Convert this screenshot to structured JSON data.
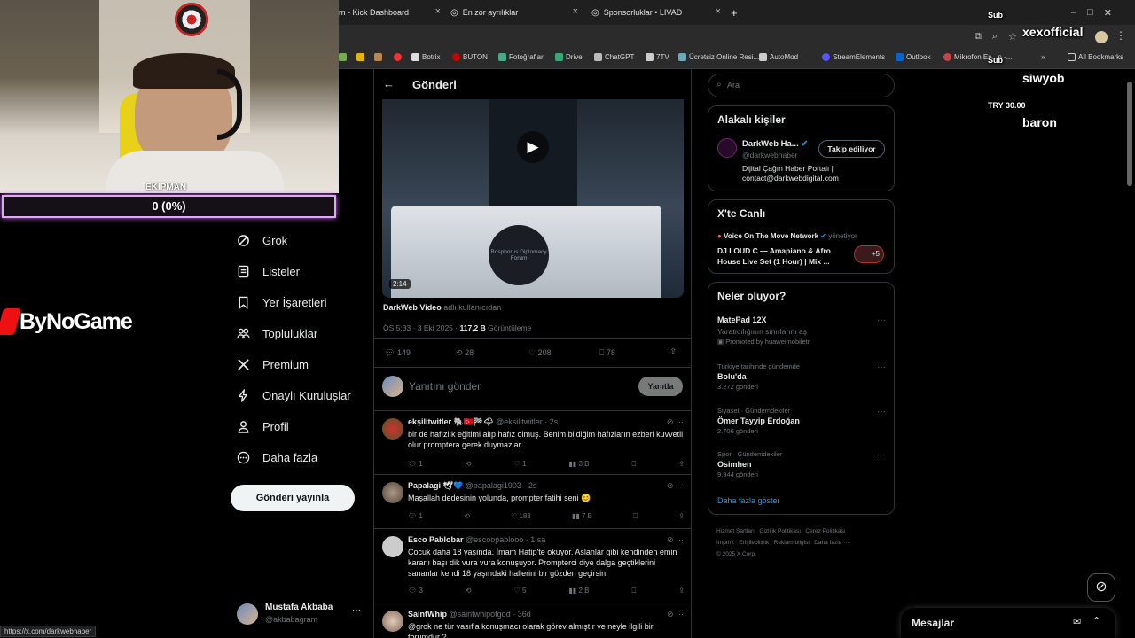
{
  "browser": {
    "tabs": [
      {
        "title": "m - Kick Dashboard"
      },
      {
        "title": "En zor ayrılıklar"
      },
      {
        "title": "Sponsorluklar • LIVAD"
      }
    ],
    "new_tab": "+",
    "bookmarks": [
      "Botrix",
      "BUTON",
      "Fotoğraflar",
      "Drive",
      "ChatGPT",
      "7TV",
      "Ücretsiz Online Resi...",
      "AutoMod",
      "StreamElements",
      "Outlook",
      "Mikrofon En...n -..."
    ],
    "all_bookmarks": "All Bookmarks",
    "status_url": "https://x.com/darkwebhaber"
  },
  "stream": {
    "ekip_label": "EKIPMAN",
    "progress_text": "0 (0%)",
    "progress_value": 0,
    "sponsor_logo": "ByNoGame",
    "sub_label_1": "Sub",
    "sub_name_1": "xexofficial",
    "sub_label_2": "Sub",
    "sub_name_2": "siwyob",
    "donation_amount": "TRY 30.00",
    "donation_name": "baron"
  },
  "sidebar": {
    "items": [
      {
        "label": "Grok",
        "icon": "grok-icon"
      },
      {
        "label": "Listeler",
        "icon": "list-icon"
      },
      {
        "label": "Yer İşaretleri",
        "icon": "bookmark-icon"
      },
      {
        "label": "Topluluklar",
        "icon": "communities-icon"
      },
      {
        "label": "Premium",
        "icon": "x-logo-icon"
      },
      {
        "label": "Onaylı Kuruluşlar",
        "icon": "lightning-icon"
      },
      {
        "label": "Profil",
        "icon": "profile-icon"
      },
      {
        "label": "Daha fazla",
        "icon": "more-circle-icon"
      }
    ],
    "post_button": "Gönderi yayınla",
    "account_name": "Mustafa Akbaba",
    "account_handle": "@akbabagram",
    "account_more": "···"
  },
  "post": {
    "header": "Gönderi",
    "video_duration": "2:14",
    "podium_text": "Bosphorus Diplomacy Forum",
    "attribution_name": "DarkWeb Video",
    "attribution_suffix": "adlı kullanıcıdan",
    "time": "ÖS 5:33 · 3 Eki 2025 ·",
    "views": "117,2 B",
    "views_label": "Görüntüleme",
    "replies": "149",
    "reposts": "28",
    "likes": "208",
    "bookmarks": "78",
    "reply_placeholder": "Yanıtını gönder",
    "reply_button": "Yanıtla"
  },
  "replies": [
    {
      "name": "ekşilitwitler 🐘🇹🇷🏁🌩",
      "handle": "@eksilitwitler · 2s",
      "text": "bir de hafızlık eğitimi alıp hafız olmuş. Benim bildiğim hafızların ezberi kuvvetli olur promptera gerek duymazlar.",
      "replies": "1",
      "reposts": "",
      "likes": "1",
      "views": "3 B"
    },
    {
      "name": "Papalagi 🕊💙",
      "handle": "@papalagi1903 · 2s",
      "text": "Maşallah dedesinin yolunda, prompter fatihi seni 😊",
      "replies": "1",
      "reposts": "",
      "likes": "183",
      "views": "7 B"
    },
    {
      "name": "Esco Pablobar",
      "handle": "@escoopablooo · 1 sa",
      "text": "Çocuk daha 18 yaşında. İmam Hatip'te okuyor. Aslanlar gibi kendinden emin kararlı başı dik vura vura konuşuyor. Prompterci diye dalga geçtiklerini sananlar kendi 18 yaşındaki hallerini bir gözden geçirsin.",
      "replies": "3",
      "reposts": "",
      "likes": "5",
      "views": "2 B"
    },
    {
      "name": "SaintWhip",
      "handle": "@saintwhipofgod · 36d",
      "text": "@grok ne tür vasıfla konuşmacı olarak görev almıştır ve neyle ilgili bir forumdur ?",
      "replies": "",
      "reposts": "",
      "likes": "",
      "views": ""
    }
  ],
  "right": {
    "search_placeholder": "Ara",
    "related_title": "Alakalı kişiler",
    "related_name": "DarkWeb Ha...",
    "related_handle": "@darkwebhaber",
    "related_bio": "Dijital Çağın Haber Portalı | contact@darkwebdigital.com",
    "follow_button": "Takip ediliyor",
    "live_title": "X'te Canlı",
    "live_host": "Voice On The Move Network",
    "live_host_suffix": "yönetiyor",
    "live_title_text": "DJ LOUD C — Amapiano & Afro House Live Set (1 Hour) | Mix ...",
    "live_count": "+5",
    "trends_title": "Neler oluyor?",
    "trends": [
      {
        "name": "MatePad 12X",
        "category": "Yaratıcılığının sınırlarını aş",
        "posts": "Promoted by huaweimobiletr"
      },
      {
        "category": "Türkiye tarihinde gündemde",
        "name": "Bolu'da",
        "posts": "3.272 gönderi"
      },
      {
        "category": "Siyaset · Gündemdekiler",
        "name": "Ömer Tayyip Erdoğan",
        "posts": "2.706 gönderi"
      },
      {
        "category": "Spor · Gündemdekiler",
        "name": "Osimhen",
        "posts": "9.944 gönderi"
      }
    ],
    "show_more": "Daha fazla göster",
    "footer_links": [
      "Hizmet Şartları",
      "Gizlilik Politikası",
      "Çerez Politikası",
      "Imprint",
      "Erişilebilirlik",
      "Reklam bilgisi",
      "Daha fazla ···"
    ],
    "copyright": "© 2025 X Corp.",
    "messages_label": "Mesajlar"
  },
  "colors": {
    "accent": "#1d9bf0",
    "progress_border": "#e2a6f5",
    "bg": "#000000"
  }
}
